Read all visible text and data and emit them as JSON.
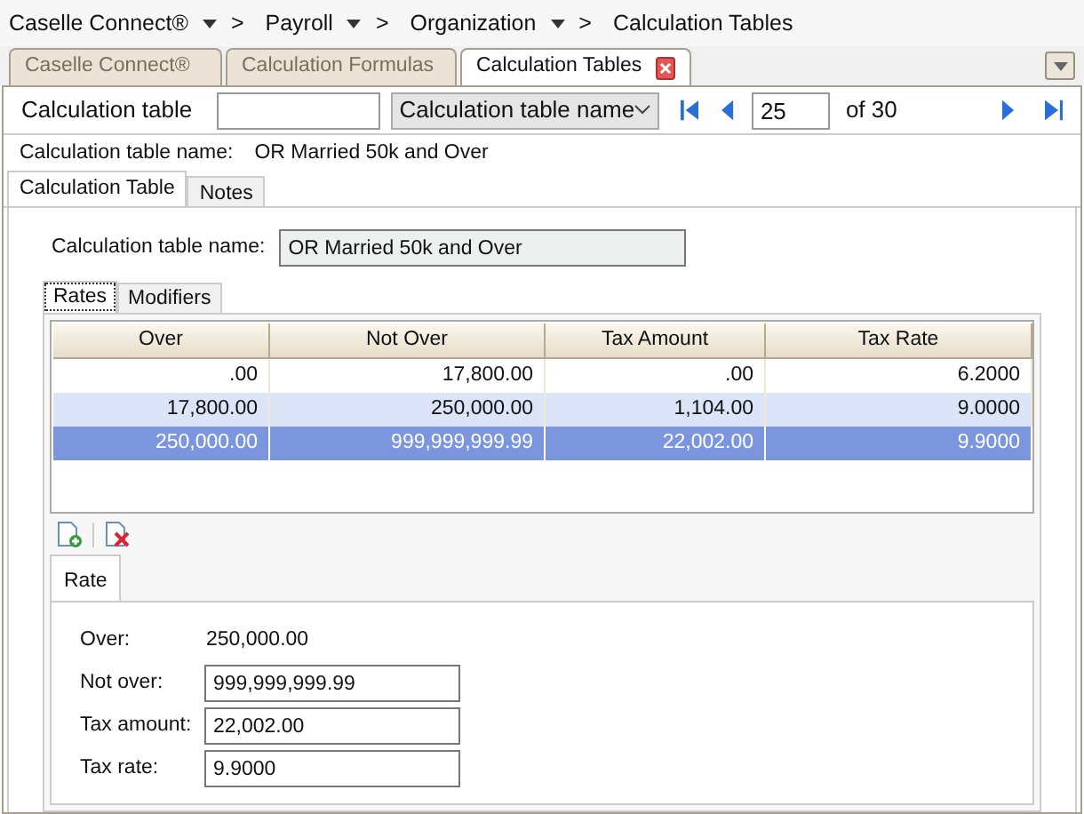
{
  "breadcrumb": [
    {
      "label": "Caselle Connect®",
      "dropdown": true
    },
    {
      "label": "Payroll",
      "dropdown": true
    },
    {
      "label": "Organization",
      "dropdown": true
    },
    {
      "label": "Calculation Tables",
      "dropdown": false
    }
  ],
  "breadcrumb_separator": ">",
  "tabs": [
    {
      "label": "Caselle Connect®",
      "selected": false,
      "closable": false
    },
    {
      "label": "Calculation Formulas",
      "selected": false,
      "closable": false
    },
    {
      "label": "Calculation Tables",
      "selected": true,
      "closable": true
    }
  ],
  "toolbar": {
    "label": "Calculation table",
    "sort_by": "Calculation table name",
    "record_value": "25",
    "of": "of 30"
  },
  "summary": {
    "label": "Calculation table name:",
    "value": "OR Married 50k and Over"
  },
  "detail_tabs": [
    {
      "label": "Calculation Table",
      "selected": true
    },
    {
      "label": "Notes",
      "selected": false
    }
  ],
  "name_field": {
    "label": "Calculation table name:",
    "value": "OR Married 50k and Over"
  },
  "sub_tabs": [
    {
      "label": "Rates",
      "selected": true
    },
    {
      "label": "Modifiers",
      "selected": false
    }
  ],
  "table": {
    "columns": [
      "Over",
      "Not Over",
      "Tax Amount",
      "Tax Rate"
    ],
    "rows": [
      {
        "cells": [
          ".00",
          "17,800.00",
          ".00",
          "6.2000"
        ],
        "selected": false
      },
      {
        "cells": [
          "17,800.00",
          "250,000.00",
          "1,104.00",
          "9.0000"
        ],
        "selected": false
      },
      {
        "cells": [
          "250,000.00",
          "999,999,999.99",
          "22,002.00",
          "9.9000"
        ],
        "selected": true
      }
    ]
  },
  "rate_tab": "Rate",
  "rate_fields": [
    {
      "label": "Over:",
      "value": "250,000.00",
      "kind": "text"
    },
    {
      "label": "Not over:",
      "value": "999,999,999.99",
      "kind": "input"
    },
    {
      "label": "Tax amount:",
      "value": "22,002.00",
      "kind": "input"
    },
    {
      "label": "Tax rate:",
      "value": "9.9000",
      "kind": "input"
    }
  ]
}
